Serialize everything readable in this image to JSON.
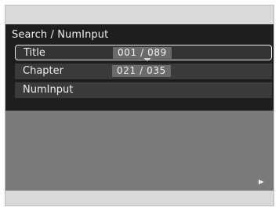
{
  "header": {
    "title": "Search / NumInput"
  },
  "menu": {
    "items": [
      {
        "label": "Title",
        "value": "001 / 089",
        "selected": true
      },
      {
        "label": "Chapter",
        "value": "021 / 035",
        "selected": false
      },
      {
        "label": "NumInput",
        "value": "",
        "selected": false
      }
    ]
  },
  "icons": {
    "play": "play-icon",
    "caret": "caret-down-icon"
  }
}
